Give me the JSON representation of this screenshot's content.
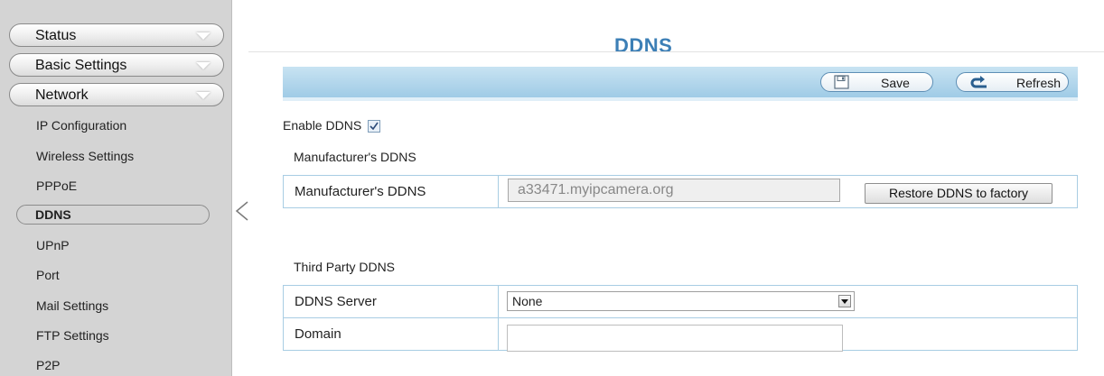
{
  "sidebar": {
    "top_buttons": [
      "Status",
      "Basic Settings",
      "Network"
    ],
    "items": [
      "IP Configuration",
      "Wireless Settings",
      "PPPoE",
      "DDNS",
      "UPnP",
      "Port",
      "Mail Settings",
      "FTP Settings",
      "P2P"
    ],
    "active_item": "DDNS"
  },
  "page": {
    "title": "DDNS"
  },
  "toolbar": {
    "save_label": "Save",
    "refresh_label": "Refresh"
  },
  "enable": {
    "label": "Enable DDNS",
    "checked": true
  },
  "manufacturer": {
    "section_title": "Manufacturer's DDNS",
    "field_label": "Manufacturer's DDNS",
    "field_value": "a33471.myipcamera.org",
    "restore_label": "Restore DDNS to factory"
  },
  "third_party": {
    "section_title": "Third Party DDNS",
    "server_label": "DDNS Server",
    "server_value": "None",
    "domain_label": "Domain",
    "domain_value": ""
  },
  "colors": {
    "title": "#3c7fb6",
    "toolbar": "#b4d8ee",
    "table_border": "#a8cde3",
    "sidebar": "#d4d4d4"
  },
  "icons": {
    "save": "floppy-disk-icon",
    "refresh": "undo-arrow-icon",
    "dropdown": "chevron-down-icon"
  }
}
